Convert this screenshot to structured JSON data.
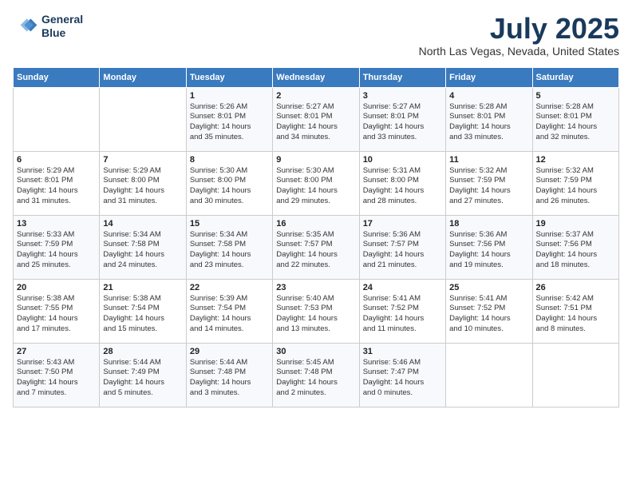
{
  "logo": {
    "line1": "General",
    "line2": "Blue"
  },
  "title": "July 2025",
  "location": "North Las Vegas, Nevada, United States",
  "weekdays": [
    "Sunday",
    "Monday",
    "Tuesday",
    "Wednesday",
    "Thursday",
    "Friday",
    "Saturday"
  ],
  "weeks": [
    [
      {
        "day": "",
        "detail": ""
      },
      {
        "day": "",
        "detail": ""
      },
      {
        "day": "1",
        "detail": "Sunrise: 5:26 AM\nSunset: 8:01 PM\nDaylight: 14 hours\nand 35 minutes."
      },
      {
        "day": "2",
        "detail": "Sunrise: 5:27 AM\nSunset: 8:01 PM\nDaylight: 14 hours\nand 34 minutes."
      },
      {
        "day": "3",
        "detail": "Sunrise: 5:27 AM\nSunset: 8:01 PM\nDaylight: 14 hours\nand 33 minutes."
      },
      {
        "day": "4",
        "detail": "Sunrise: 5:28 AM\nSunset: 8:01 PM\nDaylight: 14 hours\nand 33 minutes."
      },
      {
        "day": "5",
        "detail": "Sunrise: 5:28 AM\nSunset: 8:01 PM\nDaylight: 14 hours\nand 32 minutes."
      }
    ],
    [
      {
        "day": "6",
        "detail": "Sunrise: 5:29 AM\nSunset: 8:01 PM\nDaylight: 14 hours\nand 31 minutes."
      },
      {
        "day": "7",
        "detail": "Sunrise: 5:29 AM\nSunset: 8:00 PM\nDaylight: 14 hours\nand 31 minutes."
      },
      {
        "day": "8",
        "detail": "Sunrise: 5:30 AM\nSunset: 8:00 PM\nDaylight: 14 hours\nand 30 minutes."
      },
      {
        "day": "9",
        "detail": "Sunrise: 5:30 AM\nSunset: 8:00 PM\nDaylight: 14 hours\nand 29 minutes."
      },
      {
        "day": "10",
        "detail": "Sunrise: 5:31 AM\nSunset: 8:00 PM\nDaylight: 14 hours\nand 28 minutes."
      },
      {
        "day": "11",
        "detail": "Sunrise: 5:32 AM\nSunset: 7:59 PM\nDaylight: 14 hours\nand 27 minutes."
      },
      {
        "day": "12",
        "detail": "Sunrise: 5:32 AM\nSunset: 7:59 PM\nDaylight: 14 hours\nand 26 minutes."
      }
    ],
    [
      {
        "day": "13",
        "detail": "Sunrise: 5:33 AM\nSunset: 7:59 PM\nDaylight: 14 hours\nand 25 minutes."
      },
      {
        "day": "14",
        "detail": "Sunrise: 5:34 AM\nSunset: 7:58 PM\nDaylight: 14 hours\nand 24 minutes."
      },
      {
        "day": "15",
        "detail": "Sunrise: 5:34 AM\nSunset: 7:58 PM\nDaylight: 14 hours\nand 23 minutes."
      },
      {
        "day": "16",
        "detail": "Sunrise: 5:35 AM\nSunset: 7:57 PM\nDaylight: 14 hours\nand 22 minutes."
      },
      {
        "day": "17",
        "detail": "Sunrise: 5:36 AM\nSunset: 7:57 PM\nDaylight: 14 hours\nand 21 minutes."
      },
      {
        "day": "18",
        "detail": "Sunrise: 5:36 AM\nSunset: 7:56 PM\nDaylight: 14 hours\nand 19 minutes."
      },
      {
        "day": "19",
        "detail": "Sunrise: 5:37 AM\nSunset: 7:56 PM\nDaylight: 14 hours\nand 18 minutes."
      }
    ],
    [
      {
        "day": "20",
        "detail": "Sunrise: 5:38 AM\nSunset: 7:55 PM\nDaylight: 14 hours\nand 17 minutes."
      },
      {
        "day": "21",
        "detail": "Sunrise: 5:38 AM\nSunset: 7:54 PM\nDaylight: 14 hours\nand 15 minutes."
      },
      {
        "day": "22",
        "detail": "Sunrise: 5:39 AM\nSunset: 7:54 PM\nDaylight: 14 hours\nand 14 minutes."
      },
      {
        "day": "23",
        "detail": "Sunrise: 5:40 AM\nSunset: 7:53 PM\nDaylight: 14 hours\nand 13 minutes."
      },
      {
        "day": "24",
        "detail": "Sunrise: 5:41 AM\nSunset: 7:52 PM\nDaylight: 14 hours\nand 11 minutes."
      },
      {
        "day": "25",
        "detail": "Sunrise: 5:41 AM\nSunset: 7:52 PM\nDaylight: 14 hours\nand 10 minutes."
      },
      {
        "day": "26",
        "detail": "Sunrise: 5:42 AM\nSunset: 7:51 PM\nDaylight: 14 hours\nand 8 minutes."
      }
    ],
    [
      {
        "day": "27",
        "detail": "Sunrise: 5:43 AM\nSunset: 7:50 PM\nDaylight: 14 hours\nand 7 minutes."
      },
      {
        "day": "28",
        "detail": "Sunrise: 5:44 AM\nSunset: 7:49 PM\nDaylight: 14 hours\nand 5 minutes."
      },
      {
        "day": "29",
        "detail": "Sunrise: 5:44 AM\nSunset: 7:48 PM\nDaylight: 14 hours\nand 3 minutes."
      },
      {
        "day": "30",
        "detail": "Sunrise: 5:45 AM\nSunset: 7:48 PM\nDaylight: 14 hours\nand 2 minutes."
      },
      {
        "day": "31",
        "detail": "Sunrise: 5:46 AM\nSunset: 7:47 PM\nDaylight: 14 hours\nand 0 minutes."
      },
      {
        "day": "",
        "detail": ""
      },
      {
        "day": "",
        "detail": ""
      }
    ]
  ]
}
